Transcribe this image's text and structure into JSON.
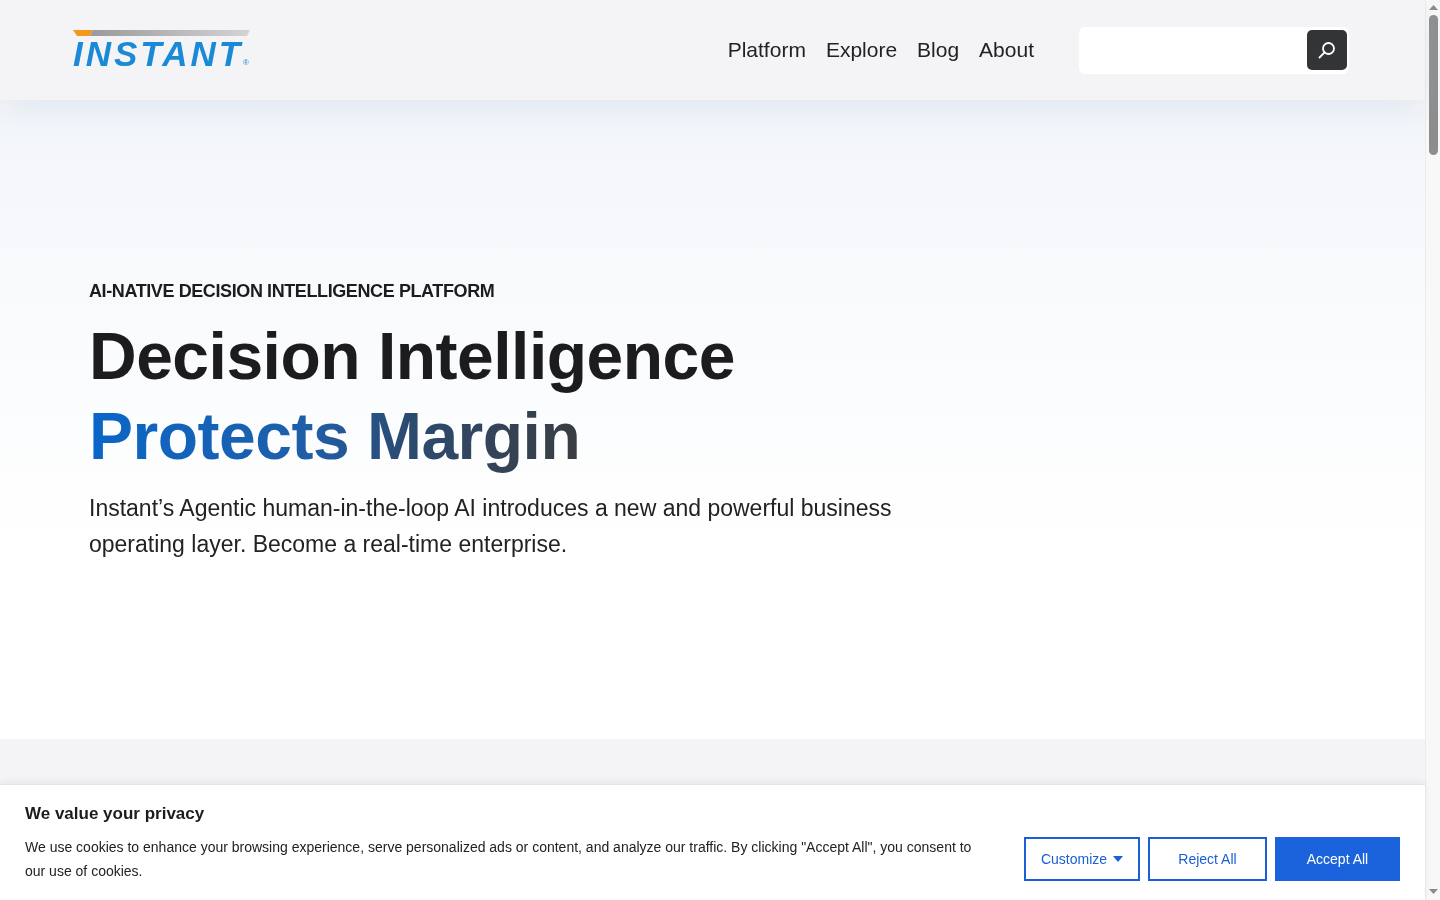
{
  "header": {
    "logo": {
      "text": "INSTANT",
      "mark": "®"
    },
    "nav": [
      "Platform",
      "Explore",
      "Blog",
      "About"
    ]
  },
  "hero": {
    "eyebrow": "AI-NATIVE DECISION INTELLIGENCE PLATFORM",
    "heading": {
      "line_1": "Decision Intelligence",
      "line_2": "Protects Margin"
    },
    "text": "Instant’s Agentic human-in-the-loop AI introduces a new and powerful business operating layer. Become a real-time enterprise."
  },
  "cookie_banner": {
    "title": "We value your privacy",
    "text": "We use cookies to enhance your browsing experience, serve personalized ads or content, and analyze our traffic. By clicking \"Accept All\", you consent to our use of cookies.",
    "buttons": [
      {
        "label": "Customize",
        "kind": "dropdown"
      },
      {
        "label": "Reject All",
        "kind": "outline"
      },
      {
        "label": "Accept All",
        "kind": "primary"
      }
    ]
  }
}
